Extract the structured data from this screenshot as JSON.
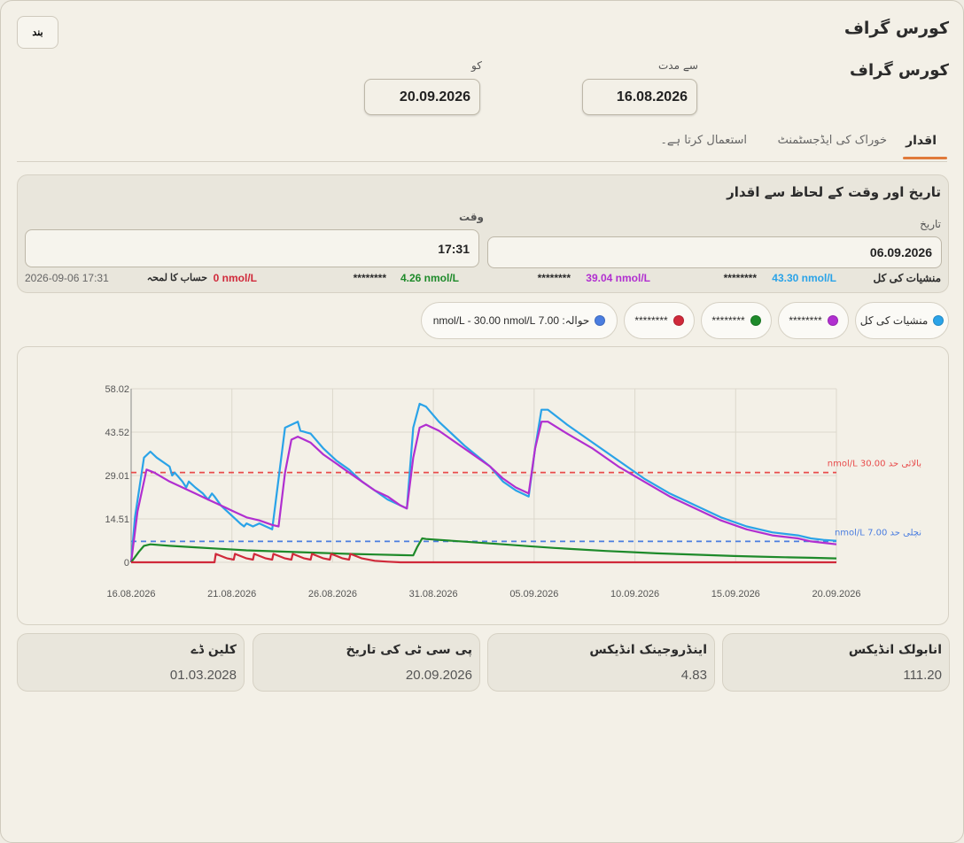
{
  "window": {
    "title": "کورس گراف",
    "close_label": "بند"
  },
  "section": {
    "title": "کورس گراف"
  },
  "range": {
    "from_label": "سے مدت",
    "from_value": "16.08.2026",
    "to_label": "کو",
    "to_value": "20.09.2026"
  },
  "tabs": [
    {
      "label": "اقدار",
      "active": true
    },
    {
      "label": "خوراک کی ایڈجسٹمنٹ",
      "active": false
    },
    {
      "label": "استعمال کرتا ہے۔",
      "active": false
    }
  ],
  "levels": {
    "title": "تاریخ اور وقت کے لحاظ سے اقدار",
    "date_label": "تاریخ",
    "date_value": "06.09.2026",
    "time_label": "وقت",
    "time_value": "17:31",
    "values": [
      {
        "name": "منشیات کی کل",
        "value": "43.30 nmol/L",
        "color": "#2aa3e8"
      },
      {
        "name": "********",
        "value": "39.04 nmol/L",
        "color": "#b12fd0"
      },
      {
        "name": "********",
        "value": "4.26 nmol/L",
        "color": "#1e8a2a"
      },
      {
        "name": "********",
        "value": "0 nmol/L",
        "color": "#d0293a"
      }
    ],
    "calc_label": "حساب کا لمحہ",
    "calc_value": "2026-09-06 17:31"
  },
  "legend": [
    {
      "label": "منشیات کی کل",
      "color": "#2aa3e8"
    },
    {
      "label": "********",
      "color": "#b12fd0"
    },
    {
      "label": "********",
      "color": "#1e8a2a"
    },
    {
      "label": "********",
      "color": "#d0293a"
    },
    {
      "label": "حوالہ: 7.00 nmol/L - 30.00 nmol/L",
      "color": "#4a7de0"
    }
  ],
  "chart_data": {
    "type": "line",
    "x_unit": "days since 16.08.2026",
    "x_ticks": [
      "16.08.2026",
      "21.08.2026",
      "26.08.2026",
      "31.08.2026",
      "05.09.2026",
      "10.09.2026",
      "15.09.2026",
      "20.09.2026"
    ],
    "y_ticks": [
      "0",
      "14.51",
      "29.01",
      "43.52",
      "58.02"
    ],
    "ylim": [
      0,
      58.02
    ],
    "xlim": [
      0,
      35
    ],
    "reference_lines": [
      {
        "label": "بالائی حد 30.00 nmol/L",
        "value": 30.0,
        "color": "#e84b4b"
      },
      {
        "label": "نچلی حد 7.00 nmol/L",
        "value": 7.0,
        "color": "#4a7de0"
      }
    ],
    "series": [
      {
        "name": "منشیات کی کل",
        "color": "#2aa3e8",
        "points": [
          [
            0,
            0
          ],
          [
            0.3,
            15
          ],
          [
            1,
            35
          ],
          [
            1.5,
            37
          ],
          [
            2,
            35
          ],
          [
            3,
            32
          ],
          [
            3.2,
            29
          ],
          [
            3.4,
            30
          ],
          [
            4,
            27
          ],
          [
            4.3,
            25
          ],
          [
            4.5,
            27
          ],
          [
            5,
            25
          ],
          [
            5.6,
            23
          ],
          [
            6,
            21
          ],
          [
            6.3,
            23
          ],
          [
            6.5,
            22
          ],
          [
            7,
            19
          ],
          [
            7.5,
            17
          ],
          [
            8,
            15
          ],
          [
            8.5,
            13
          ],
          [
            8.8,
            12
          ],
          [
            9,
            13
          ],
          [
            9.5,
            12
          ],
          [
            10,
            13
          ],
          [
            10.5,
            12
          ],
          [
            11,
            11
          ],
          [
            12,
            45
          ],
          [
            12.5,
            46
          ],
          [
            13,
            47
          ],
          [
            13.2,
            44
          ],
          [
            14,
            43
          ],
          [
            15,
            38
          ],
          [
            16,
            34
          ],
          [
            17,
            31
          ],
          [
            18,
            27
          ],
          [
            19,
            24
          ],
          [
            20,
            21
          ],
          [
            21,
            19
          ],
          [
            21.5,
            18
          ],
          [
            22,
            45
          ],
          [
            22.5,
            53
          ],
          [
            23,
            52
          ],
          [
            24,
            47
          ],
          [
            26,
            39
          ],
          [
            28,
            32
          ],
          [
            29,
            27
          ],
          [
            30,
            24
          ],
          [
            31,
            22
          ],
          [
            31.5,
            38
          ],
          [
            32,
            51
          ],
          [
            32.5,
            51
          ],
          [
            34,
            46
          ],
          [
            36,
            40
          ],
          [
            38,
            34
          ],
          [
            40,
            28
          ],
          [
            42,
            23
          ],
          [
            44,
            19
          ],
          [
            46,
            15
          ],
          [
            48,
            12
          ],
          [
            50,
            10
          ],
          [
            52,
            9
          ],
          [
            53,
            8
          ],
          [
            54,
            7.5
          ],
          [
            55,
            7.2
          ]
        ]
      },
      {
        "name": "********",
        "color": "#b12fd0",
        "points": [
          [
            0,
            0
          ],
          [
            0.5,
            17
          ],
          [
            1.2,
            31
          ],
          [
            1.8,
            30
          ],
          [
            3,
            27
          ],
          [
            4,
            25
          ],
          [
            5,
            23
          ],
          [
            6,
            21
          ],
          [
            7,
            19
          ],
          [
            8,
            17
          ],
          [
            9,
            15
          ],
          [
            10,
            14
          ],
          [
            11,
            12.5
          ],
          [
            11.5,
            12
          ],
          [
            12,
            30
          ],
          [
            12.5,
            41
          ],
          [
            13,
            42
          ],
          [
            14,
            40
          ],
          [
            15,
            36
          ],
          [
            16,
            33
          ],
          [
            17,
            30
          ],
          [
            18,
            27
          ],
          [
            19,
            24
          ],
          [
            20,
            22
          ],
          [
            21,
            19
          ],
          [
            21.5,
            18
          ],
          [
            22,
            35
          ],
          [
            22.5,
            45
          ],
          [
            23,
            46
          ],
          [
            24,
            44
          ],
          [
            26,
            38
          ],
          [
            28,
            32
          ],
          [
            29,
            28
          ],
          [
            30,
            25
          ],
          [
            31,
            23
          ],
          [
            31.5,
            38
          ],
          [
            32,
            47
          ],
          [
            32.5,
            47
          ],
          [
            34,
            43
          ],
          [
            36,
            38
          ],
          [
            38,
            32
          ],
          [
            40,
            27
          ],
          [
            42,
            22
          ],
          [
            44,
            18
          ],
          [
            46,
            14
          ],
          [
            48,
            11
          ],
          [
            50,
            9
          ],
          [
            52,
            8
          ],
          [
            53,
            7
          ],
          [
            54,
            6.5
          ],
          [
            55,
            6
          ]
        ]
      },
      {
        "name": "********",
        "color": "#1e8a2a",
        "points": [
          [
            0,
            0
          ],
          [
            0.6,
            3.5
          ],
          [
            1,
            5.5
          ],
          [
            1.5,
            6
          ],
          [
            3,
            5.5
          ],
          [
            5,
            5
          ],
          [
            7,
            4.5
          ],
          [
            9,
            4
          ],
          [
            11,
            3.7
          ],
          [
            13,
            3.4
          ],
          [
            15,
            3.1
          ],
          [
            17,
            2.8
          ],
          [
            19,
            2.6
          ],
          [
            21,
            2.4
          ],
          [
            22,
            2.3
          ],
          [
            22.3,
            5
          ],
          [
            22.7,
            8
          ],
          [
            23,
            7.8
          ],
          [
            25,
            7.2
          ],
          [
            27,
            6.6
          ],
          [
            29,
            6
          ],
          [
            31,
            5.4
          ],
          [
            33,
            4.8
          ],
          [
            35,
            4.3
          ],
          [
            37,
            3.8
          ],
          [
            39,
            3.4
          ],
          [
            41,
            3
          ],
          [
            43,
            2.7
          ],
          [
            45,
            2.4
          ],
          [
            47,
            2.1
          ],
          [
            49,
            1.9
          ],
          [
            51,
            1.7
          ],
          [
            53,
            1.5
          ],
          [
            55,
            1.3
          ]
        ]
      },
      {
        "name": "********",
        "color": "#d0293a",
        "points": [
          [
            0,
            0
          ],
          [
            6.5,
            0
          ],
          [
            6.6,
            2.8
          ],
          [
            7.5,
            1.3
          ],
          [
            8.0,
            0.9
          ],
          [
            8.1,
            2.8
          ],
          [
            9.0,
            1.3
          ],
          [
            9.5,
            0.9
          ],
          [
            9.6,
            2.8
          ],
          [
            10.5,
            1.3
          ],
          [
            11.0,
            0.9
          ],
          [
            11.1,
            2.8
          ],
          [
            12.0,
            1.3
          ],
          [
            12.5,
            0.9
          ],
          [
            12.6,
            2.8
          ],
          [
            13.5,
            1.3
          ],
          [
            14.0,
            0.9
          ],
          [
            14.1,
            2.8
          ],
          [
            15.0,
            1.3
          ],
          [
            15.5,
            0.9
          ],
          [
            15.6,
            2.8
          ],
          [
            16.5,
            1.3
          ],
          [
            17.0,
            0.9
          ],
          [
            17.1,
            2.8
          ],
          [
            18.0,
            1.3
          ],
          [
            19,
            0.5
          ],
          [
            20,
            0.2
          ],
          [
            21,
            0
          ],
          [
            55,
            0
          ]
        ]
      }
    ]
  },
  "cards": [
    {
      "title": "انابولک انڈیکس",
      "value": "111.20"
    },
    {
      "title": "اینڈروجینک انڈیکس",
      "value": "4.83"
    },
    {
      "title": "پی سی ٹی کی تاریخ",
      "value": "20.09.2026"
    },
    {
      "title": "کلین ڈے",
      "value": "01.03.2028"
    }
  ]
}
